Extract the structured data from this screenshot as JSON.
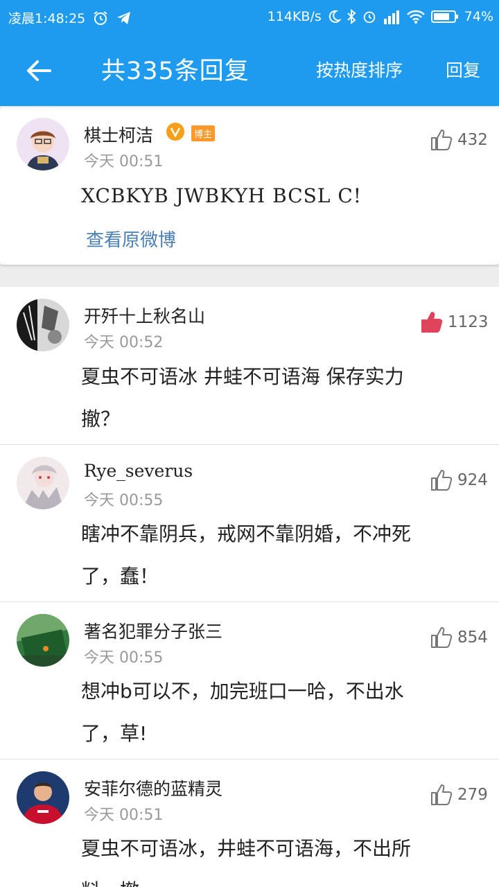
{
  "status_bar": {
    "time": "凌晨1:48:25",
    "speed": "114KB/s",
    "battery": "74%"
  },
  "nav": {
    "title": "共335条回复",
    "sort_label": "按热度排序",
    "reply_label": "回复"
  },
  "post": {
    "author": "棋士柯洁",
    "host_badge": "博主",
    "time": "今天 00:51",
    "content": "XCBKYB JWBKYH BCSL  C!",
    "likes": "432",
    "view_original": "查看原微博"
  },
  "comments": [
    {
      "author": "开歼十上秋名山",
      "time": "今天 00:52",
      "lines": [
        "夏虫不可语冰 井蛙不可语海 保存实力",
        "撤？"
      ],
      "likes": "1123",
      "liked": true
    },
    {
      "author": "Rye_severus",
      "time": "今天 00:55",
      "lines": [
        "瞎冲不靠阴兵，戒网不靠阴婚，不冲死",
        "了，蠢！"
      ],
      "likes": "924",
      "liked": false
    },
    {
      "author": "著名犯罪分子张三",
      "time": "今天 00:55",
      "lines": [
        "想冲b可以不，加完班口一哈，不出水",
        "了，草!"
      ],
      "likes": "854",
      "liked": false
    },
    {
      "author": "安菲尔德的蓝精灵",
      "time": "今天 00:51",
      "lines": [
        "夏虫不可语冰，井蛙不可语海，不出所",
        "料，撤"
      ],
      "likes": "279",
      "liked": false
    }
  ],
  "colors": {
    "accent": "#1e9bef",
    "liked": "#e0445c",
    "link": "#4a7fb5",
    "badge": "#ff9a2a"
  }
}
